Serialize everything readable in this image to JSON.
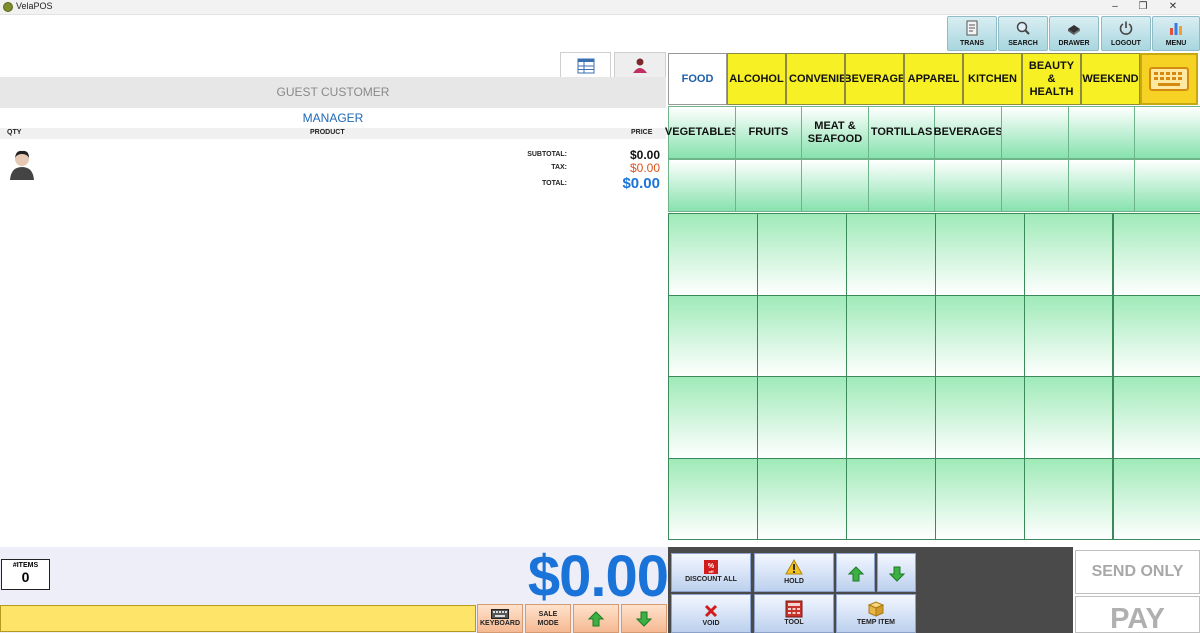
{
  "window": {
    "title": "VelaPOS"
  },
  "toolbar": [
    {
      "label": "TRANS",
      "icon": "receipt-icon"
    },
    {
      "label": "SEARCH",
      "icon": "search-icon"
    },
    {
      "label": "DRAWER",
      "icon": "drawer-icon"
    },
    {
      "label": "LOGOUT",
      "icon": "power-icon"
    },
    {
      "label": "MENU",
      "icon": "bar-chart-icon"
    }
  ],
  "order": {
    "customer": "GUEST CUSTOMER",
    "employee": "MANAGER",
    "columns": {
      "qty": "QTY",
      "product": "PRODUCT",
      "price": "PRICE"
    },
    "subtotal_label": "SUBTOTAL:",
    "subtotal": "$0.00",
    "tax_label": "TAX:",
    "tax": "$0.00",
    "total_label": "TOTAL:",
    "total": "$0.00",
    "items_label": "#ITEMS",
    "items_count": "0",
    "grand_total": "$0.00"
  },
  "bottom_left": {
    "keyboard_label": "KEYBOARD",
    "sale_mode_label": "SALE MODE"
  },
  "categories": [
    "FOOD",
    "ALCOHOL",
    "CONVENIEN",
    "BEVERAGE",
    "APPAREL",
    "KITCHEN",
    "BEAUTY & HEALTH",
    "WEEKEND"
  ],
  "subcategories": [
    "VEGETABLES",
    "FRUITS",
    "MEAT & SEAFOOD",
    "TORTILLAS",
    "BEVERAGES"
  ],
  "actions": {
    "discount_all": "DISCOUNT ALL",
    "hold": "HOLD",
    "void": "VOID",
    "tool": "TOOL",
    "temp_item": "TEMP ITEM",
    "send_only": "SEND ONLY",
    "pay": "PAY"
  },
  "colors": {
    "category_yellow": "#f6f024",
    "product_green": "#9feab8",
    "total_blue": "#1a73d8",
    "input_yellow": "#ffe46a"
  }
}
